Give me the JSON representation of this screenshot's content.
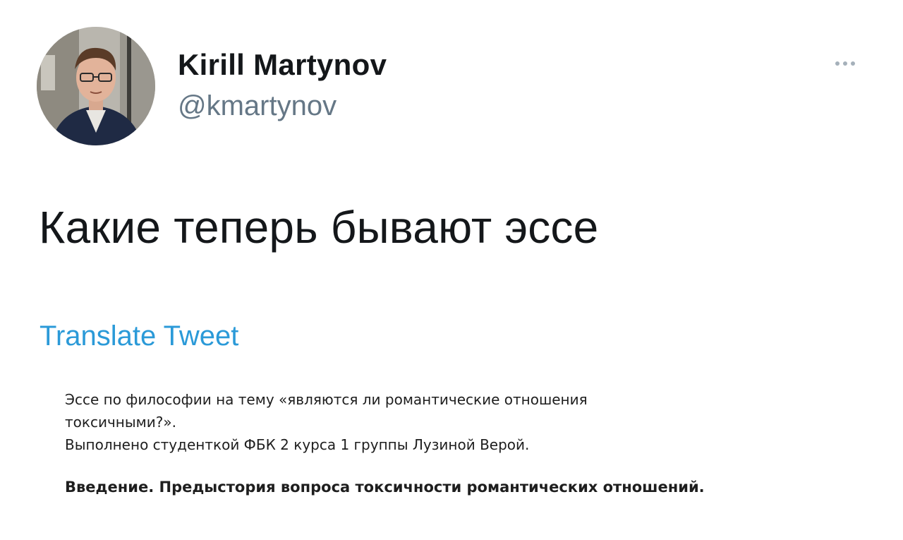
{
  "author": {
    "display_name": "Kirill Martynov",
    "handle": "@kmartynov",
    "avatar_icon": "profile-photo"
  },
  "more_icon": "ellipsis-icon",
  "tweet": {
    "text": "Какие теперь бывают эссе",
    "translate_label": "Translate Tweet"
  },
  "essay": {
    "line1": "Эссе по философии на тему «являются ли романтические отношения",
    "line2": "токсичными?».",
    "line3": "Выполнено студенткой ФБК 2 курса 1 группы Лузиной Верой.",
    "heading": "Введение. Предыстория вопроса токсичности романтических отношений."
  },
  "colors": {
    "text": "#14171a",
    "secondary": "#657786",
    "link": "#2b9ad8"
  }
}
